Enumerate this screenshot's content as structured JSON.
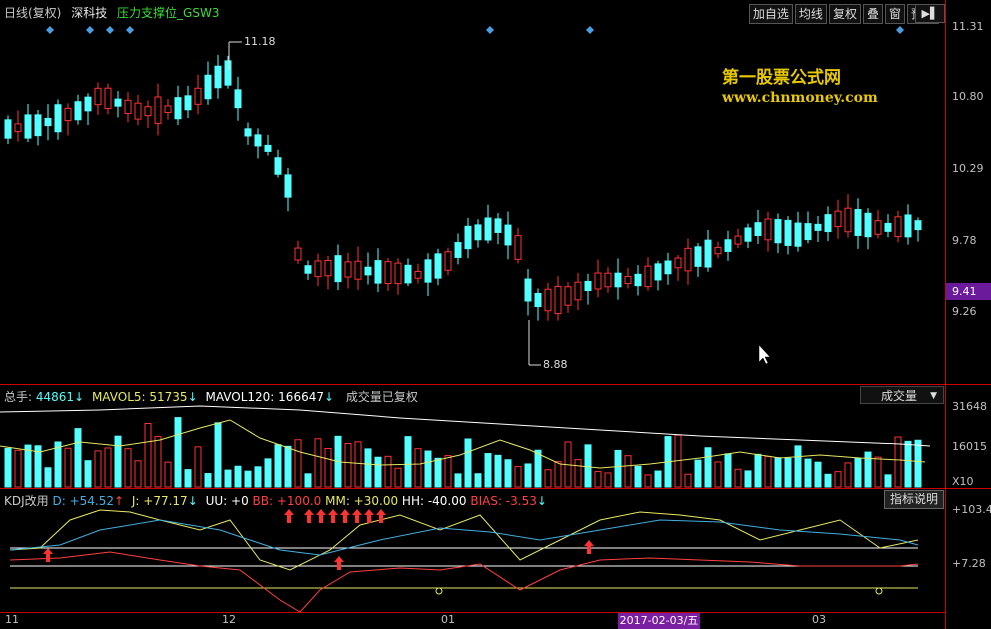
{
  "header": {
    "period": "日线(复权)",
    "stock": "深科技",
    "indicator": "压力支撑位_GSW3"
  },
  "toolbar": [
    "加自选",
    "均线",
    "复权",
    "叠",
    "窗",
    "预测"
  ],
  "watermark": {
    "line1": "第一股票公式网",
    "line2": "www.chnmoney.com"
  },
  "price_axis": [
    "11.31",
    "10.80",
    "10.29",
    "9.78",
    "9.26"
  ],
  "current_price": "9.41",
  "annotations": {
    "high": "11.18",
    "low": "8.88"
  },
  "volume_panel": {
    "total_label": "总手:",
    "total_value": "44861",
    "mavol5_label": "MAVOL5:",
    "mavol5_value": "51735",
    "mavol120_label": "MAVOL120:",
    "mavol120_value": "166647",
    "note": "成交量已复权",
    "dropdown": "成交量",
    "axis": [
      "31648",
      "16015"
    ],
    "unit": "X10"
  },
  "kdj_panel": {
    "name": "KDJ改用",
    "d": "D: +54.52",
    "j": "J: +77.17",
    "uu": "UU: +0",
    "bb": "BB: +100.0",
    "mm": "MM: +30.00",
    "hh": "HH: -40.00",
    "bias": "BIAS: -3.53",
    "help": "指标说明",
    "axis": [
      "+103.4",
      "+7.28"
    ]
  },
  "dates": {
    "m1": "11",
    "m2": "12",
    "m3": "01",
    "selected": "2017-02-03/五",
    "m4": "03"
  },
  "colors": {
    "up": "#ff3232",
    "down": "#54ffff",
    "border": "#c00000",
    "purple": "#7a1fa2"
  }
}
